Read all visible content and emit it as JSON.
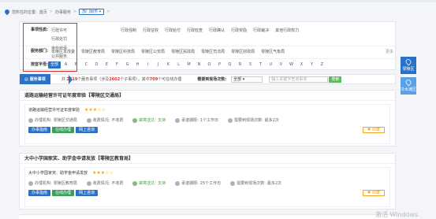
{
  "breadcrumb": {
    "location_label": "您所在的位置:",
    "items": [
      "首页",
      "办事服务",
      "部门服务"
    ]
  },
  "filters": {
    "category": {
      "label": "事项性质:",
      "items": [
        "行政许可",
        "行政处罚",
        "审核转报",
        "公共服务"
      ],
      "items_right": [
        "行政强制",
        "行政征收",
        "行政给付",
        "行政检查",
        "行政确认",
        "行政奖励",
        "行政裁决",
        "其他行政权力"
      ]
    },
    "department": {
      "label": "服务部门:",
      "items": [
        "零陵区发改委",
        "零陵区教育局",
        "零陵区科技局",
        "零陵区公安局",
        "零陵区民政局",
        "零陵区司法局",
        "零陵区财政局",
        "零陵区气象局"
      ],
      "more": "更多"
    },
    "letters": {
      "label": "按首字母:",
      "items": [
        "全部",
        "A",
        "B",
        "C",
        "D",
        "E",
        "F",
        "G",
        "H",
        "I",
        "J",
        "K",
        "L",
        "M",
        "N",
        "O",
        "P",
        "Q",
        "R",
        "S",
        "T",
        "U",
        "V",
        "W",
        "X",
        "Y",
        "Z"
      ]
    }
  },
  "toolbar": {
    "tag": "服务事项",
    "stats_prefix": "共",
    "total": "2419",
    "stats_mid1": "个服务事项（涉及",
    "sub_total": "2602",
    "stats_mid2": "个子事项），其中",
    "not_online": "709",
    "stats_suffix": "个可在线办理",
    "sort_label": "需要到现场次数:",
    "sort_value": "全部",
    "search_placeholder": "输入关键字查询事项",
    "search_button": "搜索"
  },
  "cards": [
    {
      "title": "道路运输经营许可证年度审验【零陵区交通局】",
      "sub": "道路运输经营许可证年度审验",
      "stars": "★★★☆☆",
      "agency_label": "办理机构:",
      "agency": "零陵区交通局",
      "fee_label": "收费情况:",
      "fee": "不收费",
      "mail_label": "邮寄送达:",
      "mail": "支持",
      "days_label": "承诺期限:",
      "days": "1个工作日",
      "visits_label": "需要到现场次数:",
      "visits": "最多2次",
      "actions": [
        "办事指南",
        "在线办理",
        "网上咨询"
      ],
      "favorite": "收藏"
    },
    {
      "title": "大中小学国家奖、助学金申请发放【零陵区教育局】",
      "sub": "大中小学国家奖、助学金申请发放",
      "stars": "★★★☆☆",
      "agency_label": "办理机构:",
      "agency": "零陵区教育局",
      "fee_label": "收费情况:",
      "fee": "不收费",
      "mail_label": "邮寄送达:",
      "mail": "支持",
      "days_label": "承诺期限:",
      "days": "25个工作日",
      "visits_label": "需要到现场次数:",
      "visits": "最多2次",
      "actions": [
        "办事指南",
        "在线办理",
        "网上咨询"
      ],
      "favorite": "收藏"
    }
  ],
  "side": {
    "btn1": "零陵区",
    "btn2": "冷水滩区"
  },
  "watermark": "激活 Windows"
}
